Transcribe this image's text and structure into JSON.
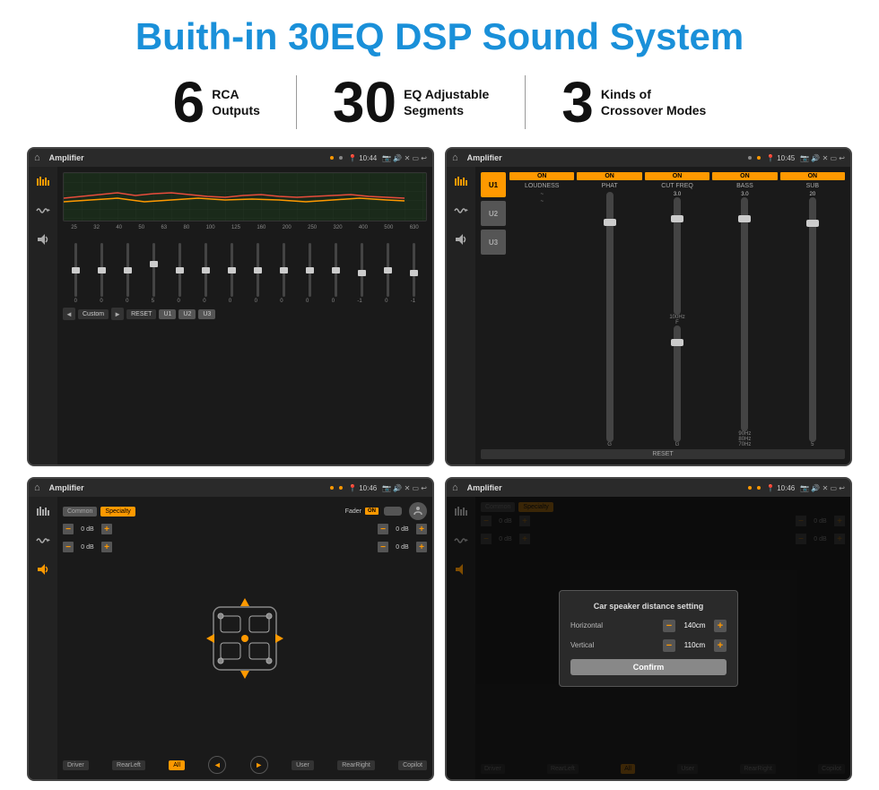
{
  "title": "Buith-in 30EQ DSP Sound System",
  "stats": [
    {
      "number": "6",
      "text": "RCA\nOutputs"
    },
    {
      "number": "30",
      "text": "EQ Adjustable\nSegments"
    },
    {
      "number": "3",
      "text": "Kinds of\nCrossover Modes"
    }
  ],
  "screens": {
    "eq": {
      "status": {
        "app": "Amplifier",
        "time": "10:44"
      },
      "freq_labels": [
        "25",
        "32",
        "40",
        "50",
        "63",
        "80",
        "100",
        "125",
        "160",
        "200",
        "250",
        "320",
        "400",
        "500",
        "630"
      ],
      "values": [
        "0",
        "0",
        "0",
        "5",
        "0",
        "0",
        "0",
        "0",
        "0",
        "0",
        "0",
        "-1",
        "0",
        "-1"
      ],
      "buttons": [
        "Custom",
        "RESET",
        "U1",
        "U2",
        "U3"
      ]
    },
    "crossover": {
      "status": {
        "app": "Amplifier",
        "time": "10:45"
      },
      "u_buttons": [
        "U1",
        "U2",
        "U3"
      ],
      "channels": [
        {
          "label": "LOUDNESS",
          "on": true
        },
        {
          "label": "PHAT",
          "on": true
        },
        {
          "label": "CUT FREQ",
          "on": true
        },
        {
          "label": "BASS",
          "on": true
        },
        {
          "label": "SUB",
          "on": true
        }
      ],
      "reset_label": "RESET"
    },
    "fader": {
      "status": {
        "app": "Amplifier",
        "time": "10:46"
      },
      "common_btn": "Common",
      "specialty_btn": "Specialty",
      "fader_label": "Fader",
      "on_label": "ON",
      "db_values": [
        "0 dB",
        "0 dB",
        "0 dB",
        "0 dB"
      ],
      "buttons": [
        "Driver",
        "RearLeft",
        "All",
        "User",
        "RearRight",
        "Copilot"
      ]
    },
    "dialog": {
      "status": {
        "app": "Amplifier",
        "time": "10:46"
      },
      "dialog_title": "Car speaker distance setting",
      "horizontal_label": "Horizontal",
      "horizontal_value": "140cm",
      "vertical_label": "Vertical",
      "vertical_value": "110cm",
      "confirm_label": "Confirm"
    }
  }
}
